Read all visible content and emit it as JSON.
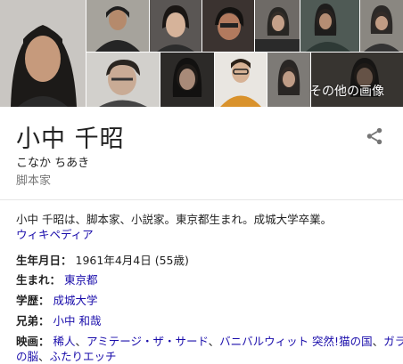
{
  "images": {
    "more_label": "その他の画像"
  },
  "entity": {
    "name": "小中 千昭",
    "reading": "こなか ちあき",
    "occupation": "脚本家",
    "description": "小中 千昭は、脚本家、小説家。東京都生まれ。成城大学卒業。",
    "source_link": "ウィキペディア"
  },
  "facts": {
    "birth": {
      "label": "生年月日",
      "sep": "：",
      "date": "1961年4月4日",
      "age": "(55歳)"
    },
    "birthplace": {
      "label": "生まれ",
      "sep": "：",
      "value": "東京都"
    },
    "education": {
      "label": "学歴",
      "sep": "：",
      "value": "成城大学"
    },
    "sibling": {
      "label": "兄弟",
      "sep": "：",
      "value": "小中 和哉"
    },
    "films": {
      "label": "映画",
      "sep": "：",
      "line1": [
        "稀人",
        "、",
        "アミテージ・ザ・サード",
        "、",
        "バニバルウィット 突然!猫の国",
        "、",
        "ガラス"
      ],
      "line2": [
        "の脳",
        "、",
        "ふたりエッチ"
      ]
    }
  },
  "colors": {
    "link": "#1a0dab",
    "muted": "#777777",
    "text": "#222222"
  },
  "icons": {
    "share": "share-icon"
  }
}
